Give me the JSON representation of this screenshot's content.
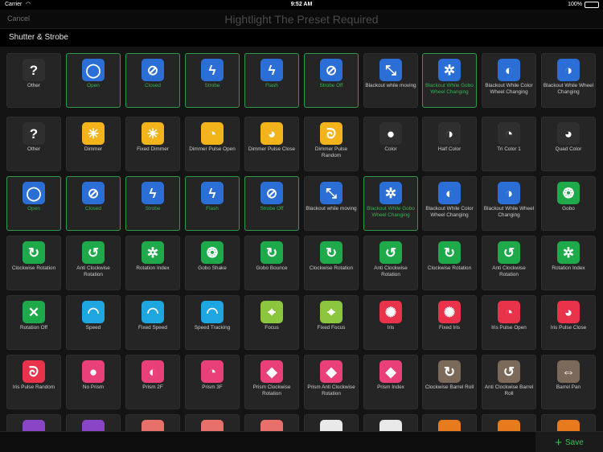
{
  "status": {
    "carrier": "Carrier",
    "time": "9:52 AM",
    "battery": "100%"
  },
  "nav": {
    "cancel": "Cancel",
    "title": "Hightlight The Preset Required"
  },
  "section_title": "Shutter & Strobe",
  "colors": {
    "selected_border": "#2e9a4a",
    "selected_text": "#35b453",
    "accent_green": "#3bbf5a"
  },
  "rows": [
    [
      {
        "label": "Other",
        "icon": "question-icon",
        "glyph": "?",
        "bg": "#2f2f2f",
        "selected": false
      },
      {
        "label": "Open",
        "icon": "shutter-open-icon",
        "glyph": "◯",
        "bg": "#2b6fd6",
        "selected": true
      },
      {
        "label": "Closed",
        "icon": "shutter-closed-icon",
        "glyph": "⊘",
        "bg": "#2b6fd6",
        "selected": true
      },
      {
        "label": "Strobe",
        "icon": "strobe-icon",
        "glyph": "ϟ",
        "bg": "#2b6fd6",
        "selected": true
      },
      {
        "label": "Flash",
        "icon": "flash-icon",
        "glyph": "ϟ",
        "bg": "#2b6fd6",
        "selected": true
      },
      {
        "label": "Strobe Off",
        "icon": "strobe-off-icon",
        "glyph": "⊘",
        "bg": "#2b6fd6",
        "selected": true
      },
      {
        "label": "Blackout while moving",
        "icon": "blackout-moving-icon",
        "glyph": "⤡",
        "bg": "#2b6fd6",
        "selected": false
      },
      {
        "label": "Blackout While Gobo Wheel Changing",
        "icon": "blackout-gobo-icon",
        "glyph": "✲",
        "bg": "#2b6fd6",
        "selected": true
      },
      {
        "label": "Blackout While Color Wheel Changing",
        "icon": "blackout-color-icon",
        "glyph": "◐",
        "bg": "#2b6fd6",
        "selected": false
      },
      {
        "label": "Blackout While Wheel Changing",
        "icon": "blackout-wheel-icon",
        "glyph": "◑",
        "bg": "#2b6fd6",
        "selected": false
      }
    ],
    [
      {
        "label": "Other",
        "icon": "question-icon",
        "glyph": "?",
        "bg": "#2f2f2f",
        "selected": false
      },
      {
        "label": "Dimmer",
        "icon": "dimmer-icon",
        "glyph": "☀",
        "bg": "#f2b31b",
        "selected": false
      },
      {
        "label": "Fixed Dimmer",
        "icon": "fixed-dimmer-icon",
        "glyph": "☀",
        "bg": "#f2b31b",
        "selected": false
      },
      {
        "label": "Dimmer Pulse Open",
        "icon": "dimmer-pulse-open-icon",
        "glyph": "◔",
        "bg": "#f2b31b",
        "selected": false
      },
      {
        "label": "Dimmer Pulse Close",
        "icon": "dimmer-pulse-close-icon",
        "glyph": "◕",
        "bg": "#f2b31b",
        "selected": false
      },
      {
        "label": "Dimmer Pulse Random",
        "icon": "dimmer-pulse-random-icon",
        "glyph": "ᘐ",
        "bg": "#f2b31b",
        "selected": false
      },
      {
        "label": "Color",
        "icon": "color-wheel-icon",
        "glyph": "●",
        "bg": "#2f2f2f",
        "selected": false
      },
      {
        "label": "Half Color",
        "icon": "half-color-icon",
        "glyph": "◑",
        "bg": "#2f2f2f",
        "selected": false
      },
      {
        "label": "Tri Color 1",
        "icon": "tri-color-icon",
        "glyph": "◔",
        "bg": "#2f2f2f",
        "selected": false
      },
      {
        "label": "Quad Color",
        "icon": "quad-color-icon",
        "glyph": "◕",
        "bg": "#2f2f2f",
        "selected": false
      }
    ],
    [
      {
        "label": "Open",
        "icon": "shutter-open-icon",
        "glyph": "◯",
        "bg": "#2b6fd6",
        "selected": true
      },
      {
        "label": "Closed",
        "icon": "shutter-closed-icon",
        "glyph": "⊘",
        "bg": "#2b6fd6",
        "selected": true
      },
      {
        "label": "Strobe",
        "icon": "strobe-icon",
        "glyph": "ϟ",
        "bg": "#2b6fd6",
        "selected": true
      },
      {
        "label": "Flash",
        "icon": "flash-icon",
        "glyph": "ϟ",
        "bg": "#2b6fd6",
        "selected": true
      },
      {
        "label": "Strobe Off",
        "icon": "strobe-off-icon",
        "glyph": "⊘",
        "bg": "#2b6fd6",
        "selected": true
      },
      {
        "label": "Blackout while moving",
        "icon": "blackout-moving-icon",
        "glyph": "⤡",
        "bg": "#2b6fd6",
        "selected": false
      },
      {
        "label": "Blackout While Gobo Wheel Changing",
        "icon": "blackout-gobo-icon",
        "glyph": "✲",
        "bg": "#2b6fd6",
        "selected": true
      },
      {
        "label": "Blackout While Color Wheel Changing",
        "icon": "blackout-color-icon",
        "glyph": "◐",
        "bg": "#2b6fd6",
        "selected": false
      },
      {
        "label": "Blackout While Wheel Changing",
        "icon": "blackout-wheel-icon",
        "glyph": "◑",
        "bg": "#2b6fd6",
        "selected": false
      },
      {
        "label": "Gobo",
        "icon": "gobo-icon",
        "glyph": "❂",
        "bg": "#1eaa4b",
        "selected": false
      }
    ],
    [
      {
        "label": "Clockwise Rotation",
        "icon": "clockwise-rotation-icon",
        "glyph": "↻",
        "bg": "#1eaa4b",
        "selected": false
      },
      {
        "label": "Anti Clockwise Rotation",
        "icon": "anticlockwise-rotation-icon",
        "glyph": "↺",
        "bg": "#1eaa4b",
        "selected": false
      },
      {
        "label": "Rotation Index",
        "icon": "rotation-index-icon",
        "glyph": "✲",
        "bg": "#1eaa4b",
        "selected": false
      },
      {
        "label": "Gobo Shake",
        "icon": "gobo-shake-icon",
        "glyph": "❂",
        "bg": "#1eaa4b",
        "selected": false
      },
      {
        "label": "Gobo Bounce",
        "icon": "gobo-bounce-icon",
        "glyph": "↻",
        "bg": "#1eaa4b",
        "selected": false
      },
      {
        "label": "Clockwise Rotation",
        "icon": "clockwise-rotation-icon",
        "glyph": "↻",
        "bg": "#1eaa4b",
        "selected": false
      },
      {
        "label": "Anti Clockwise Rotation",
        "icon": "anticlockwise-rotation-icon",
        "glyph": "↺",
        "bg": "#1eaa4b",
        "selected": false
      },
      {
        "label": "Clockwise Rotation",
        "icon": "clockwise-rotation-icon",
        "glyph": "↻",
        "bg": "#1eaa4b",
        "selected": false
      },
      {
        "label": "Anti Clockwise Rotation",
        "icon": "anticlockwise-rotation-icon",
        "glyph": "↺",
        "bg": "#1eaa4b",
        "selected": false
      },
      {
        "label": "Rotation Index",
        "icon": "rotation-index-icon",
        "glyph": "✲",
        "bg": "#1eaa4b",
        "selected": false
      }
    ],
    [
      {
        "label": "Rotation Off",
        "icon": "rotation-off-icon",
        "glyph": "✕",
        "bg": "#1eaa4b",
        "selected": false
      },
      {
        "label": "Speed",
        "icon": "speed-icon",
        "glyph": "◠",
        "bg": "#1ea6e0",
        "selected": false
      },
      {
        "label": "Fixed Speed",
        "icon": "fixed-speed-icon",
        "glyph": "◠",
        "bg": "#1ea6e0",
        "selected": false
      },
      {
        "label": "Speed Tracking",
        "icon": "speed-tracking-icon",
        "glyph": "◠",
        "bg": "#1ea6e0",
        "selected": false
      },
      {
        "label": "Focus",
        "icon": "focus-icon",
        "glyph": "⌖",
        "bg": "#8cc63f",
        "selected": false
      },
      {
        "label": "Fixed Focus",
        "icon": "fixed-focus-icon",
        "glyph": "⌖",
        "bg": "#8cc63f",
        "selected": false
      },
      {
        "label": "Iris",
        "icon": "iris-icon",
        "glyph": "✺",
        "bg": "#e8334a",
        "selected": false
      },
      {
        "label": "Fixed Iris",
        "icon": "fixed-iris-icon",
        "glyph": "✺",
        "bg": "#e8334a",
        "selected": false
      },
      {
        "label": "Iris Pulse Open",
        "icon": "iris-pulse-open-icon",
        "glyph": "◔",
        "bg": "#e8334a",
        "selected": false
      },
      {
        "label": "Iris Pulse Close",
        "icon": "iris-pulse-close-icon",
        "glyph": "◕",
        "bg": "#e8334a",
        "selected": false
      }
    ],
    [
      {
        "label": "Iris Pulse Random",
        "icon": "iris-pulse-random-icon",
        "glyph": "ᘐ",
        "bg": "#e8334a",
        "selected": false
      },
      {
        "label": "No Prism",
        "icon": "no-prism-icon",
        "glyph": "●",
        "bg": "#e9407a",
        "selected": false
      },
      {
        "label": "Prism 2F",
        "icon": "prism-2f-icon",
        "glyph": "◐",
        "bg": "#e9407a",
        "selected": false
      },
      {
        "label": "Prism 3F",
        "icon": "prism-3f-icon",
        "glyph": "◔",
        "bg": "#e9407a",
        "selected": false
      },
      {
        "label": "Prism Clockwise Rotation",
        "icon": "prism-clockwise-icon",
        "glyph": "◆",
        "bg": "#e9407a",
        "selected": false
      },
      {
        "label": "Prism Anti Clockwise Rotation",
        "icon": "prism-anticlockwise-icon",
        "glyph": "◆",
        "bg": "#e9407a",
        "selected": false
      },
      {
        "label": "Prism Index",
        "icon": "prism-index-icon",
        "glyph": "◆",
        "bg": "#e9407a",
        "selected": false
      },
      {
        "label": "Clockwise Barrel Roll",
        "icon": "clockwise-barrel-roll-icon",
        "glyph": "↻",
        "bg": "#7b6a5a",
        "selected": false
      },
      {
        "label": "Anti Clockwise Barrel Roll",
        "icon": "anticlockwise-barrel-roll-icon",
        "glyph": "↺",
        "bg": "#7b6a5a",
        "selected": false
      },
      {
        "label": "Barrel Pan",
        "icon": "barrel-pan-icon",
        "glyph": "⇔",
        "bg": "#7b6a5a",
        "selected": false
      }
    ],
    [
      {
        "label": "",
        "icon": "partial-purple-icon",
        "glyph": "",
        "bg": "#8a45c6",
        "selected": false
      },
      {
        "label": "",
        "icon": "partial-purple-icon",
        "glyph": "",
        "bg": "#8a45c6",
        "selected": false
      },
      {
        "label": "",
        "icon": "partial-salmon-icon",
        "glyph": "",
        "bg": "#e8706a",
        "selected": false
      },
      {
        "label": "",
        "icon": "partial-salmon-icon",
        "glyph": "",
        "bg": "#e8706a",
        "selected": false
      },
      {
        "label": "",
        "icon": "partial-salmon-icon",
        "glyph": "",
        "bg": "#e8706a",
        "selected": false
      },
      {
        "label": "",
        "icon": "partial-white-icon",
        "glyph": "",
        "bg": "#e9e9e9",
        "selected": false
      },
      {
        "label": "",
        "icon": "partial-white-icon",
        "glyph": "",
        "bg": "#e9e9e9",
        "selected": false
      },
      {
        "label": "",
        "icon": "partial-orange-icon",
        "glyph": "",
        "bg": "#e87a1e",
        "selected": false
      },
      {
        "label": "",
        "icon": "partial-orange-icon",
        "glyph": "",
        "bg": "#e87a1e",
        "selected": false
      },
      {
        "label": "",
        "icon": "partial-orange-icon",
        "glyph": "",
        "bg": "#e87a1e",
        "selected": false
      }
    ]
  ],
  "footer": {
    "save": "Save"
  }
}
